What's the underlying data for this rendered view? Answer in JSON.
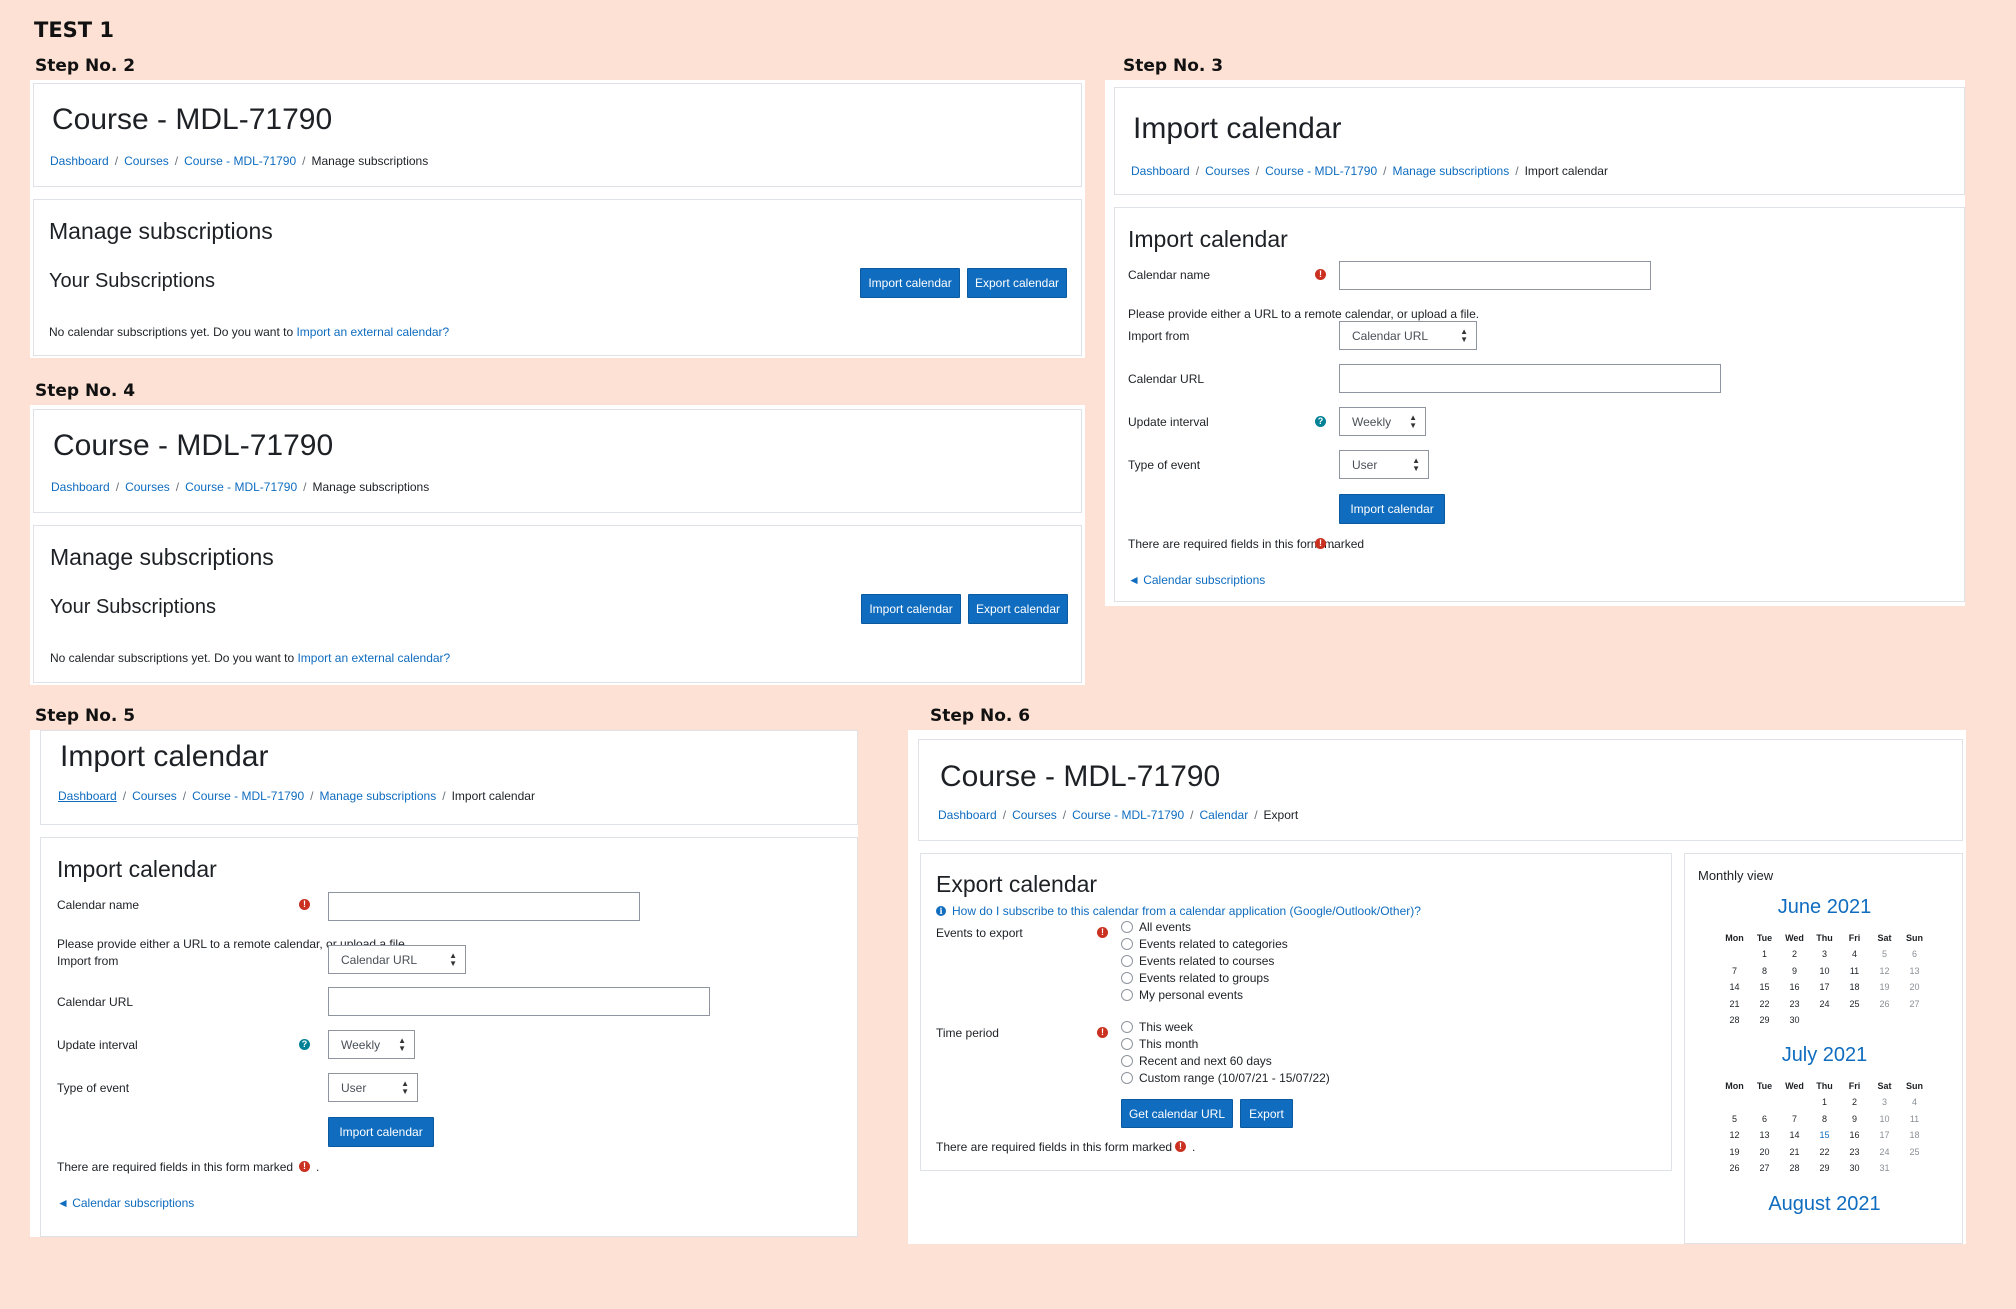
{
  "test_title": "TEST 1",
  "steps": {
    "s2": "Step No. 2",
    "s3": "Step No. 3",
    "s4": "Step No. 4",
    "s5": "Step No. 5",
    "s6": "Step No. 6"
  },
  "manage": {
    "course_title": "Course - MDL-71790",
    "breadcrumb": [
      "Dashboard",
      "Courses",
      "Course - MDL-71790",
      "Manage subscriptions"
    ],
    "heading": "Manage subscriptions",
    "subheading": "Your Subscriptions",
    "import_btn": "Import calendar",
    "export_btn": "Export calendar",
    "empty_text": "No calendar subscriptions yet. Do you want to",
    "empty_link": "Import an external calendar?"
  },
  "import": {
    "page_title": "Import calendar",
    "breadcrumb": [
      "Dashboard",
      "Courses",
      "Course - MDL-71790",
      "Manage subscriptions",
      "Import calendar"
    ],
    "form_heading": "Import calendar",
    "calendar_name_label": "Calendar name",
    "hint": "Please provide either a URL to a remote calendar, or upload a file.",
    "import_from_label": "Import from",
    "import_from_value": "Calendar URL",
    "calendar_url_label": "Calendar URL",
    "update_interval_label": "Update interval",
    "update_interval_value": "Weekly",
    "type_of_event_label": "Type of event",
    "type_of_event_value": "User",
    "submit": "Import calendar",
    "required_note": "There are required fields in this form marked",
    "back_link": "◄ Calendar subscriptions"
  },
  "export": {
    "course_title": "Course - MDL-71790",
    "breadcrumb": [
      "Dashboard",
      "Courses",
      "Course - MDL-71790",
      "Calendar",
      "Export"
    ],
    "heading": "Export calendar",
    "help_link": "How do I subscribe to this calendar from a calendar application (Google/Outlook/Other)?",
    "events_label": "Events to export",
    "events_options": [
      "All events",
      "Events related to categories",
      "Events related to courses",
      "Events related to groups",
      "My personal events"
    ],
    "period_label": "Time period",
    "period_options": [
      "This week",
      "This month",
      "Recent and next 60 days",
      "Custom range (10/07/21 - 15/07/22)"
    ],
    "get_url_btn": "Get calendar URL",
    "export_btn": "Export",
    "required_note": "There are required fields in this form marked"
  },
  "monthly": {
    "title": "Monthly view",
    "day_headers": [
      "Mon",
      "Tue",
      "Wed",
      "Thu",
      "Fri",
      "Sat",
      "Sun"
    ],
    "months": [
      {
        "name": "June 2021",
        "weeks": [
          [
            "",
            "1",
            "2",
            "3",
            "4",
            "5",
            "6"
          ],
          [
            "7",
            "8",
            "9",
            "10",
            "11",
            "12",
            "13"
          ],
          [
            "14",
            "15",
            "16",
            "17",
            "18",
            "19",
            "20"
          ],
          [
            "21",
            "22",
            "23",
            "24",
            "25",
            "26",
            "27"
          ],
          [
            "28",
            "29",
            "30",
            "",
            "",
            "",
            ""
          ]
        ]
      },
      {
        "name": "July 2021",
        "weeks": [
          [
            "",
            "",
            "",
            "1",
            "2",
            "3",
            "4"
          ],
          [
            "5",
            "6",
            "7",
            "8",
            "9",
            "10",
            "11"
          ],
          [
            "12",
            "13",
            "14",
            "15",
            "16",
            "17",
            "18"
          ],
          [
            "19",
            "20",
            "21",
            "22",
            "23",
            "24",
            "25"
          ],
          [
            "26",
            "27",
            "28",
            "29",
            "30",
            "31",
            ""
          ]
        ],
        "today": "15"
      },
      {
        "name": "August 2021",
        "weeks": []
      }
    ]
  },
  "icons": {
    "required": "!",
    "help": "?",
    "info": "i",
    "caret": "▲▼"
  },
  "colors": {
    "background": "#fce1d4",
    "primary": "#0f6cbf",
    "required": "#ca3120",
    "help": "#008196"
  }
}
